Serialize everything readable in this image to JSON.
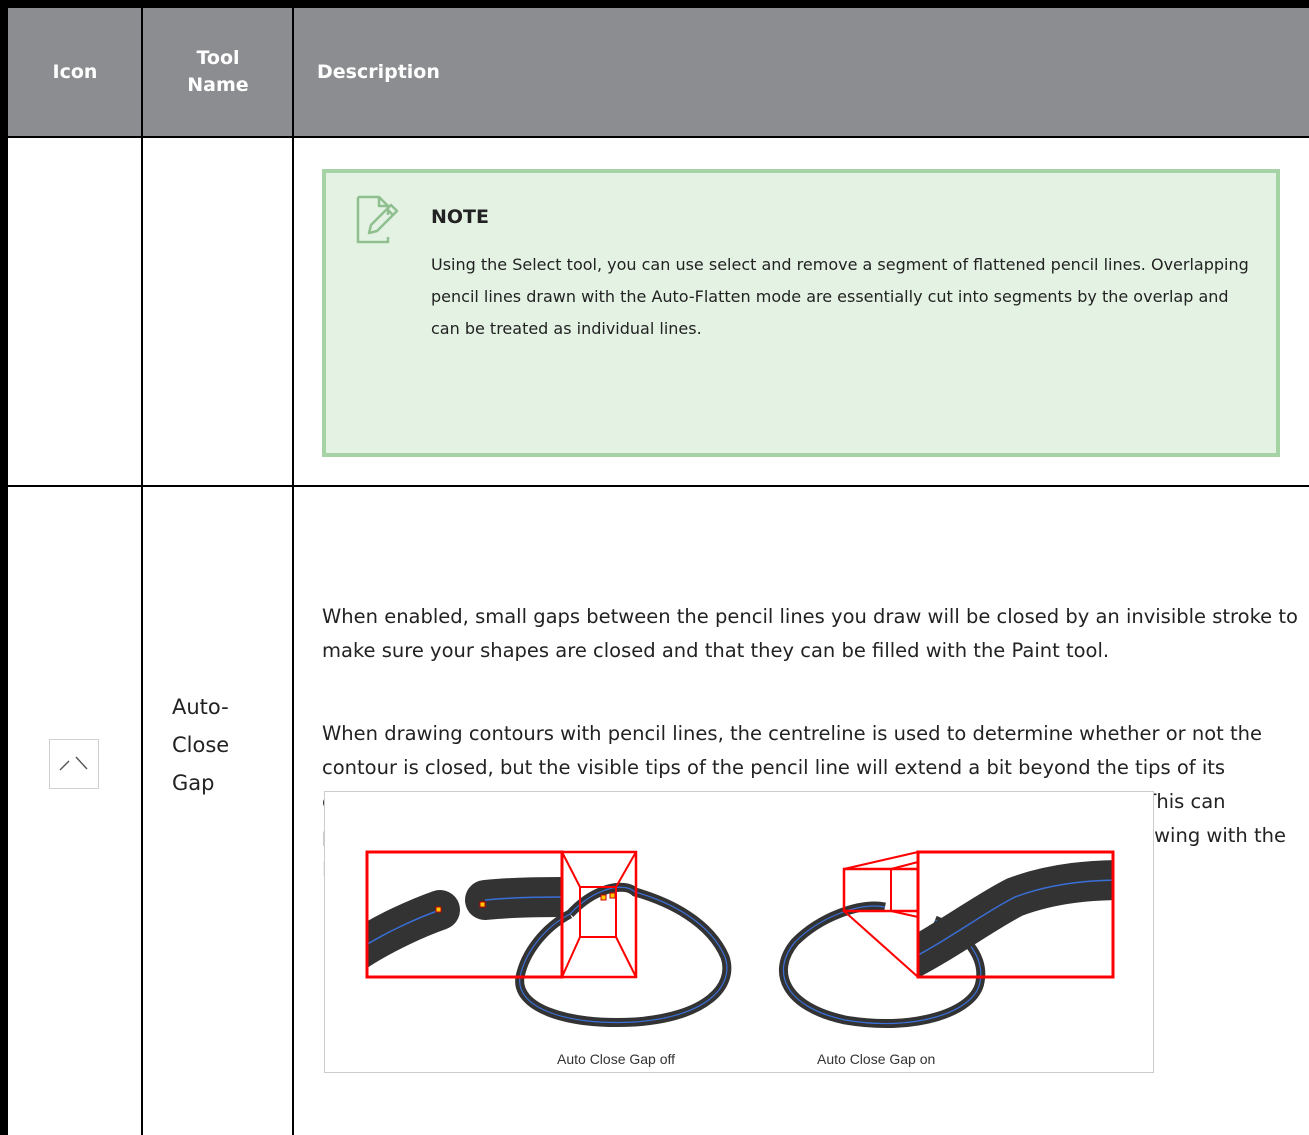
{
  "table": {
    "headers": {
      "icon": "Icon",
      "tool_name_line1": "Tool",
      "tool_name_line2": "Name",
      "description": "Description"
    }
  },
  "note": {
    "icon": "note-edit-icon",
    "title": "NOTE",
    "text": "Using the Select tool, you can use select and remove a segment of flattened pencil lines. Overlapping pencil lines drawn with the Auto-Flatten mode are essentially cut into segments by the overlap and can be treated as individual lines."
  },
  "row": {
    "icon": "auto-close-gap-icon",
    "tool_name_line1": "Auto-",
    "tool_name_line2": "Close",
    "tool_name_line3": "Gap",
    "paragraph1": "When enabled, small gaps between the pencil lines you draw will be closed by an invisible stroke to make sure your shapes are closed and that they can be filled with the Paint tool.",
    "paragraph2": "When drawing contours with pencil lines, the centreline is used to determine whether or not the contour is closed, but the visible tips of the pencil line will extend a bit beyond the tips of its centreline, making it possible to have shapes that appear closed, but are not really. This can prevent the shape from being filled with the Paint tool. Enabling this option when drawing with the Pencil or Line tool will prevent you from leaving invisible gaps in your contours.",
    "figure": {
      "caption_off": "Auto Close Gap off",
      "caption_on": "Auto Close Gap on"
    }
  },
  "colors": {
    "header_bg": "#8c8d90",
    "note_bg": "#e4f2e4",
    "note_border": "#a6d3a6",
    "zoom_red": "#ff0000",
    "stroke_dark": "#333333",
    "centreline_blue": "#3a6fd8"
  }
}
